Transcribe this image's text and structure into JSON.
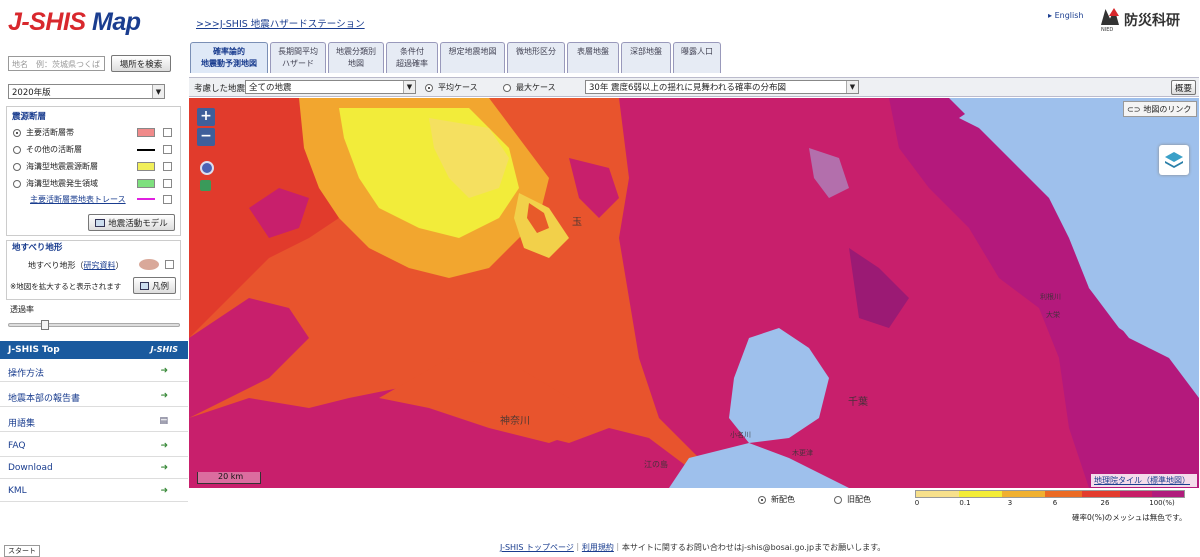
{
  "header": {
    "logo_prefix": "J-SHIS",
    "logo_suffix": " Map",
    "breadcrumb_link": ">>>J-SHIS 地震ハザードステーション",
    "english": "English",
    "nied_name": "防災科研",
    "nied_sub": "NIED"
  },
  "sidebar": {
    "search_placeholder": "地名　例：茨城県つくば",
    "search_button": "場所を検索",
    "version": "2020年版",
    "faults_title": "震源断層",
    "faults": [
      {
        "label": "主要活断層帯",
        "color": "#f08a8a",
        "selected": true,
        "type": "swatch"
      },
      {
        "label": "その他の活断層",
        "color": "#000000",
        "selected": false,
        "type": "line"
      },
      {
        "label": "海溝型地震震源断層",
        "color": "#f1ef5a",
        "selected": false,
        "type": "swatch"
      },
      {
        "label": "海溝型地震発生領域",
        "color": "#7ee07e",
        "selected": false,
        "type": "swatch"
      }
    ],
    "trace_link": "主要活断層帯地表トレース",
    "trace_color": "#e020e0",
    "model_button": "地震活動モデル",
    "landslide_title": "地すべり地形",
    "landslide_label": "地すべり地形",
    "landslide_paren_open": "（",
    "landslide_link": "研究資料",
    "landslide_paren_close": "）",
    "landslide_color": "#d9a899",
    "zoom_note": "※地図を拡大すると表示されます",
    "legend_button": "凡例",
    "opacity_label": "透過率",
    "opacity_value": 0.2,
    "top_bar": "J-SHIS Top",
    "top_bar_logo": "J-SHIS",
    "menu": [
      {
        "label": "操作方法",
        "icon": "arrow-icon"
      },
      {
        "label": "地震本部の報告書",
        "icon": "arrow-icon"
      },
      {
        "label": "用語集",
        "icon": "book-icon"
      },
      {
        "label": "FAQ",
        "icon": "arrow-icon"
      },
      {
        "label": "Download",
        "icon": "arrow-icon"
      },
      {
        "label": "KML",
        "icon": "arrow-icon"
      }
    ],
    "start": "スタート"
  },
  "tabs": [
    {
      "line1": "確率論的",
      "line2": "地震動予測地図",
      "active": true
    },
    {
      "line1": "長期間平均",
      "line2": "ハザード",
      "active": false
    },
    {
      "line1": "地震分類別",
      "line2": "地図",
      "active": false
    },
    {
      "line1": "条件付",
      "line2": "超過確率",
      "active": false
    },
    {
      "line1": "想定地震地図",
      "line2": "",
      "active": false
    },
    {
      "line1": "微地形区分",
      "line2": "",
      "active": false
    },
    {
      "line1": "表層地盤",
      "line2": "",
      "active": false
    },
    {
      "line1": "深部地盤",
      "line2": "",
      "active": false
    },
    {
      "line1": "曝露人口",
      "line2": "",
      "active": false
    }
  ],
  "toolbar": {
    "considered_label": "考慮した地震",
    "considered_value": "全ての地震",
    "mean_case": "平均ケース",
    "max_case": "最大ケース",
    "mean_selected": true,
    "map_select": "30年 震度6弱以上の揺れに見舞われる確率の分布図",
    "overview": "概要"
  },
  "map": {
    "map_link": "地図のリンク",
    "scale": "20 km",
    "attribution": "地理院タイル（標準地図）",
    "labels": [
      "神奈川",
      "千葉",
      "玉",
      "江の島",
      "小名川",
      "利根川",
      "大栄",
      "木更津"
    ]
  },
  "legend": {
    "new_color": "新配色",
    "old_color": "旧配色",
    "new_selected": true,
    "ticks": [
      "0",
      "0.1",
      "3",
      "6",
      "26",
      "100(%)"
    ],
    "colors": [
      "#f7e08b",
      "#f3ec36",
      "#f0b030",
      "#eb6a23",
      "#e33b2c",
      "#c71e66",
      "#b01c7c"
    ],
    "note": "確率0(%)のメッシュは無色です。"
  },
  "footer": {
    "top_page": "J-SHIS トップページ",
    "sep1": "｜",
    "terms": "利用規約",
    "rest": "｜本サイトに関するお問い合わせはj-shis@bosai.go.jpまでお願いします。"
  }
}
